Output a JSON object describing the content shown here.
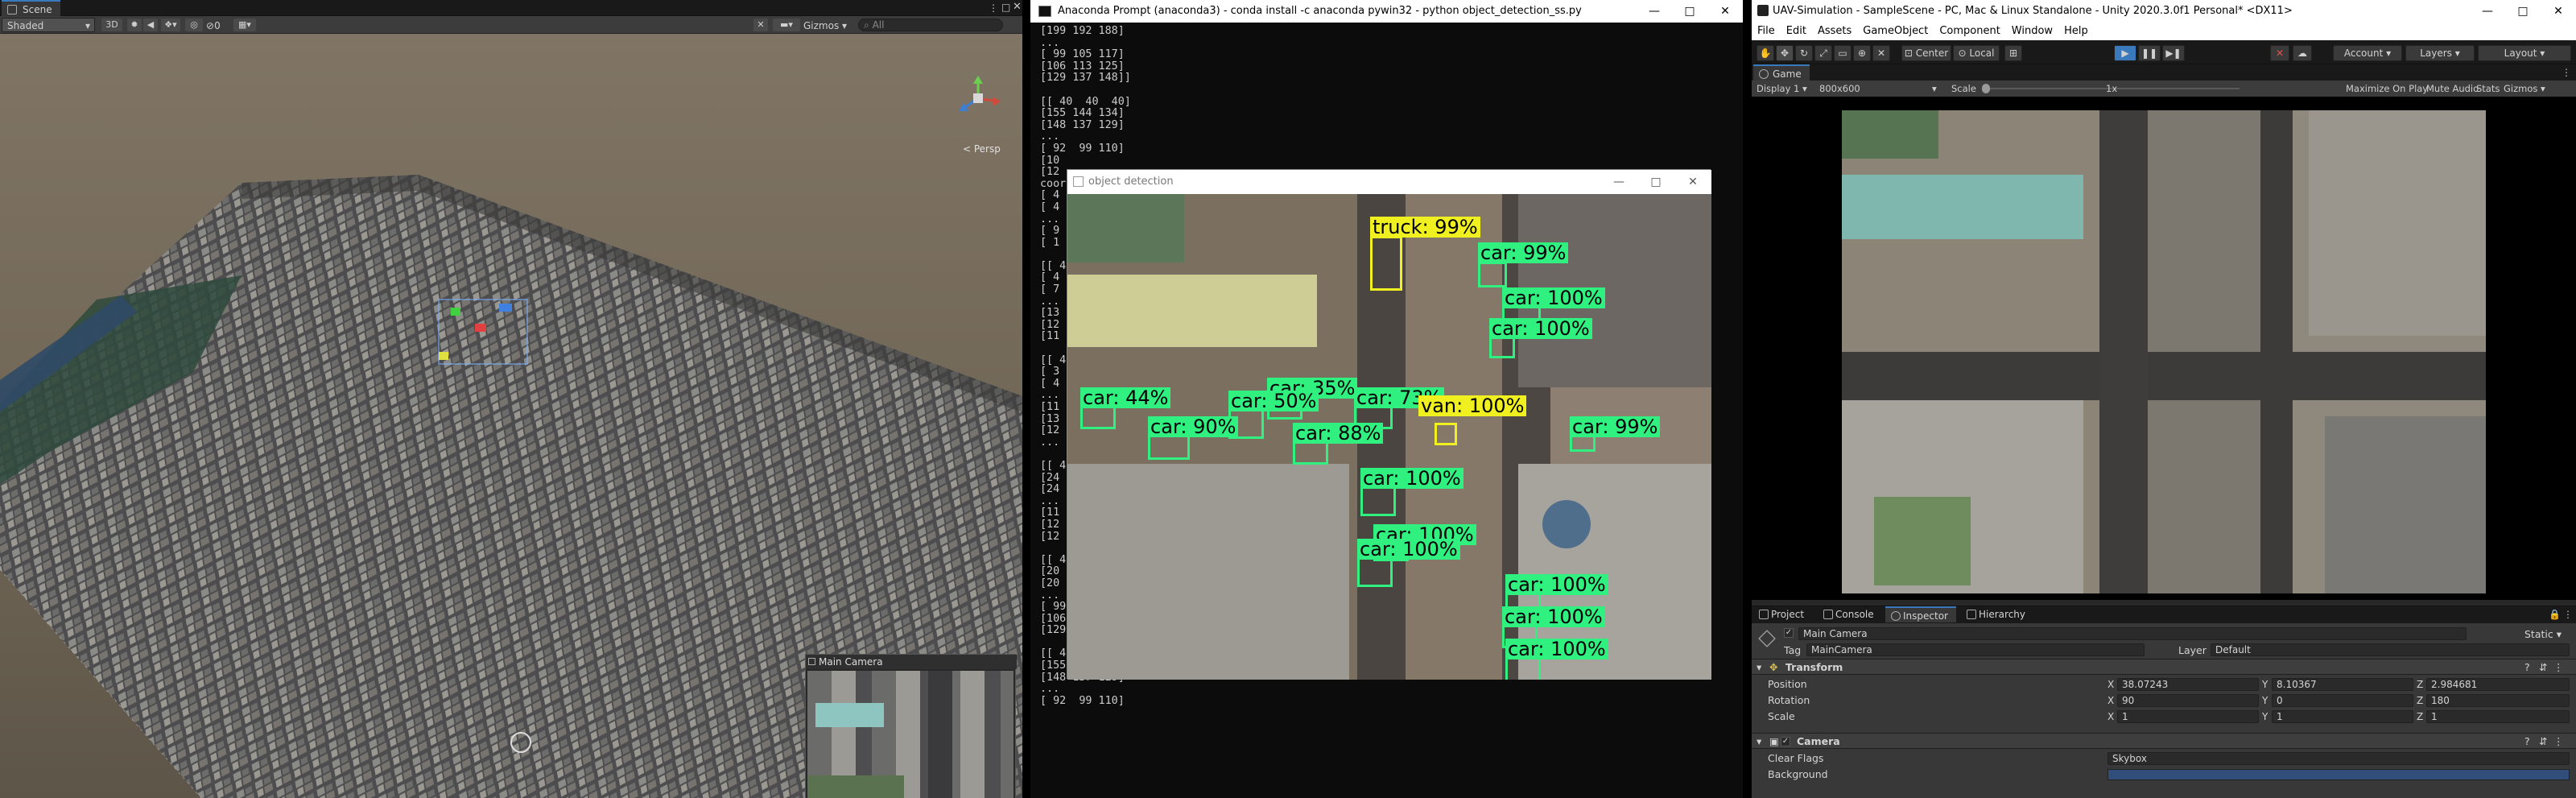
{
  "scene_window": {
    "tab_label": "Scene",
    "shading_mode": "Shaded",
    "mode_2d3d": "3D",
    "gizmos_label": "Gizmos",
    "search_placeholder": "All",
    "toolbar_counter": "0",
    "persp_label": "< Persp",
    "camera_preview_title": "Main Camera"
  },
  "terminal": {
    "title": "Anaconda Prompt (anaconda3) - conda  install -c anaconda pywin32 - python  object_detection_ss.py",
    "lines": [
      "[199 192 188]",
      "...",
      "[ 99 105 117]",
      "[106 113 125]",
      "[129 137 148]]",
      "",
      "[[ 40  40  40]",
      "[155 144 134]",
      "[148 137 129]",
      "...",
      "[ 92  99 110]",
      "[10",
      "[12",
      "coord",
      "[ 4",
      "[ 4",
      "...",
      "[ 9",
      "[ 1",
      "",
      "[[ 4",
      "[ 4",
      "[ 7",
      "...",
      "[13",
      "[12",
      "[11",
      "",
      "[[ 4",
      "[ 3",
      "[ 4",
      "...",
      "[11",
      "[13",
      "[12",
      "...",
      "",
      "[[ 4",
      "[24",
      "[24",
      "...",
      "[11",
      "[12",
      "[12",
      "",
      "[[ 4",
      "[20",
      "[20",
      "...",
      "[ 99 105 117]",
      "[106 113 125]",
      "[129 137 148]]",
      "",
      "[[ 40  40  40]",
      "[155 144 134]",
      "[148 137 129]",
      "...",
      "[ 92  99 110]"
    ]
  },
  "object_detection": {
    "title": "object detection",
    "detections": [
      {
        "label": "truck: 99%",
        "color": "yellow"
      },
      {
        "label": "car: 99%",
        "color": "green"
      },
      {
        "label": "car: 100%",
        "color": "green"
      },
      {
        "label": "car: 100%",
        "color": "green"
      },
      {
        "label": "car: 44%",
        "color": "green"
      },
      {
        "label": "car: 35%",
        "color": "green"
      },
      {
        "label": "car: 50%",
        "color": "green"
      },
      {
        "label": "car: 90%",
        "color": "green"
      },
      {
        "label": "car: 73%",
        "color": "green"
      },
      {
        "label": "car: 88%",
        "color": "green"
      },
      {
        "label": "van: 100%",
        "color": "yellow"
      },
      {
        "label": "car: 99%",
        "color": "green"
      },
      {
        "label": "car: 100%",
        "color": "green"
      },
      {
        "label": "car: 100%",
        "color": "green"
      },
      {
        "label": "car: 100%",
        "color": "green"
      },
      {
        "label": "car: 100%",
        "color": "green"
      },
      {
        "label": "car: 100%",
        "color": "green"
      },
      {
        "label": "car: 100%",
        "color": "green"
      }
    ]
  },
  "unity": {
    "title": "UAV-Simulation - SampleScene - PC, Mac & Linux Standalone - Unity 2020.3.0f1 Personal* <DX11>",
    "menu": [
      "File",
      "Edit",
      "Assets",
      "GameObject",
      "Component",
      "Window",
      "Help"
    ],
    "toolbar": {
      "pivot_label": "Center",
      "space_label": "Local",
      "account_label": "Account",
      "layers_label": "Layers",
      "layout_label": "Layout"
    },
    "game": {
      "tab_label": "Game",
      "display_label": "Display 1",
      "resolution_label": "800x600",
      "scale_label": "Scale",
      "scale_value": "1x",
      "maximize_label": "Maximize On Play",
      "mute_label": "Mute Audio",
      "stats_label": "Stats",
      "gizmos_label": "Gizmos"
    },
    "bottom_tabs": [
      "Project",
      "Console",
      "Inspector",
      "Hierarchy"
    ],
    "inspector": {
      "object_name": "Main Camera",
      "static_label": "Static",
      "tag_label": "Tag",
      "tag_value": "MainCamera",
      "layer_label": "Layer",
      "layer_value": "Default",
      "transform_label": "Transform",
      "position_label": "Position",
      "position": {
        "x": "38.07243",
        "y": "8.10367",
        "z": "2.984681"
      },
      "rotation_label": "Rotation",
      "rotation": {
        "x": "90",
        "y": "0",
        "z": "180"
      },
      "scale_label": "Scale",
      "scale": {
        "x": "1",
        "y": "1",
        "z": "1"
      },
      "camera_label": "Camera",
      "clear_flags_label": "Clear Flags",
      "clear_flags_value": "Skybox",
      "background_label": "Background"
    }
  }
}
